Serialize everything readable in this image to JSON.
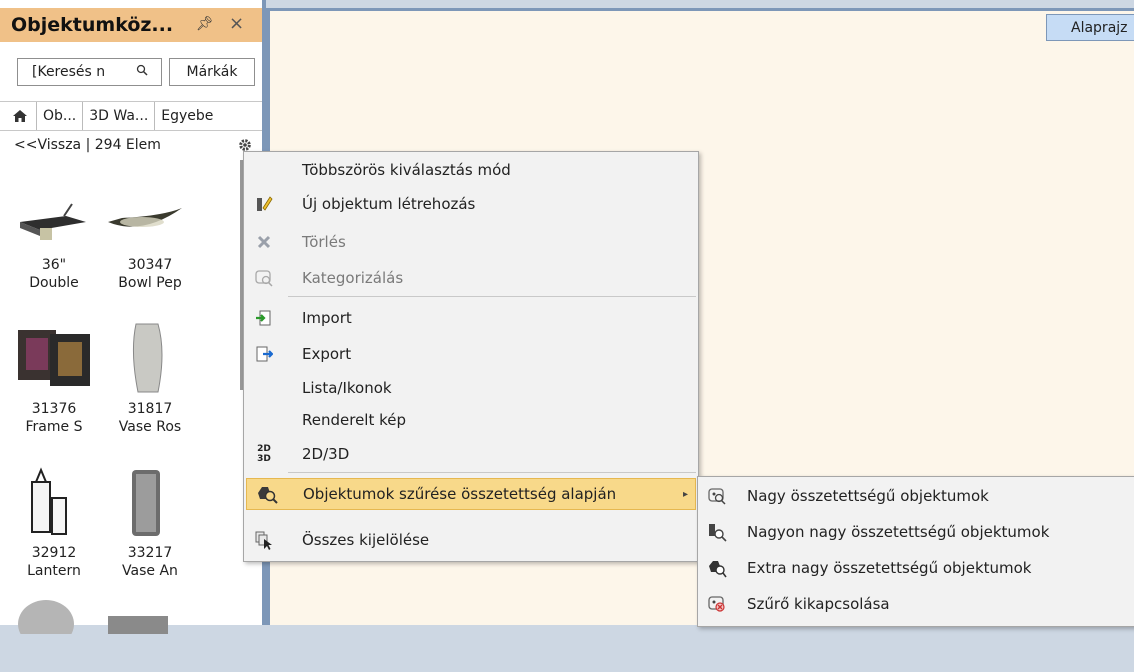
{
  "panel": {
    "title": "Objektumköz...",
    "pin_glyph": "ª",
    "close_glyph": "×",
    "search_value": "[Keresés n",
    "brands_label": "Márkák",
    "breadcrumbs": [
      "Ob...",
      "3D Wa...",
      "Egyebe"
    ],
    "back_text": "<<Vissza  |  294 Elem",
    "items": [
      {
        "num": "36\"",
        "name": "Double"
      },
      {
        "num": "30347",
        "name": "Bowl Pep"
      },
      {
        "num": "31376",
        "name": "Frame S"
      },
      {
        "num": "31817",
        "name": "Vase Ros"
      },
      {
        "num": "32912",
        "name": "Lantern"
      },
      {
        "num": "33217",
        "name": "Vase An"
      }
    ]
  },
  "canvas": {
    "tab_label": "Alaprajz"
  },
  "context_menu": {
    "items": [
      {
        "label": "Többszörös kiválasztás mód",
        "icon": "none",
        "disabled": false
      },
      {
        "label": "Új objektum létrehozás",
        "icon": "pencil-icon",
        "disabled": false
      },
      {
        "label": "Törlés",
        "icon": "delete-x-icon",
        "disabled": true
      },
      {
        "label": "Kategorizálás",
        "icon": "categorize-icon",
        "disabled": true
      },
      {
        "label": "Import",
        "icon": "import-icon",
        "disabled": false
      },
      {
        "label": "Export",
        "icon": "export-icon",
        "disabled": false
      },
      {
        "label": "Lista/Ikonok",
        "icon": "none",
        "disabled": false
      },
      {
        "label": "Renderelt kép",
        "icon": "none",
        "disabled": false
      },
      {
        "label": "2D/3D",
        "icon": "2d-3d-icon",
        "disabled": false
      },
      {
        "label": "Objektumok szűrése összetettség alapján",
        "icon": "filter-complexity-icon",
        "disabled": false,
        "highlighted": true
      },
      {
        "label": "Összes kijelölése",
        "icon": "select-all-icon",
        "disabled": false
      }
    ]
  },
  "submenu": {
    "items": [
      {
        "label": "Nagy összetettségű objektumok",
        "icon": "complexity-large-icon"
      },
      {
        "label": "Nagyon nagy összetettségű objektumok",
        "icon": "complexity-very-large-icon"
      },
      {
        "label": "Extra nagy összetettségű objektumok",
        "icon": "complexity-extra-large-icon"
      },
      {
        "label": "Szűrő kikapcsolása",
        "icon": "filter-off-icon"
      }
    ]
  },
  "icon_text": {
    "twod_top": "2D",
    "twod_bottom": "3D"
  },
  "colors": {
    "panel_title_bg": "#f0c188",
    "highlight_bg": "#f8d98a",
    "canvas_bg": "#fdf6ea",
    "frame_blue": "#7d97b8"
  }
}
